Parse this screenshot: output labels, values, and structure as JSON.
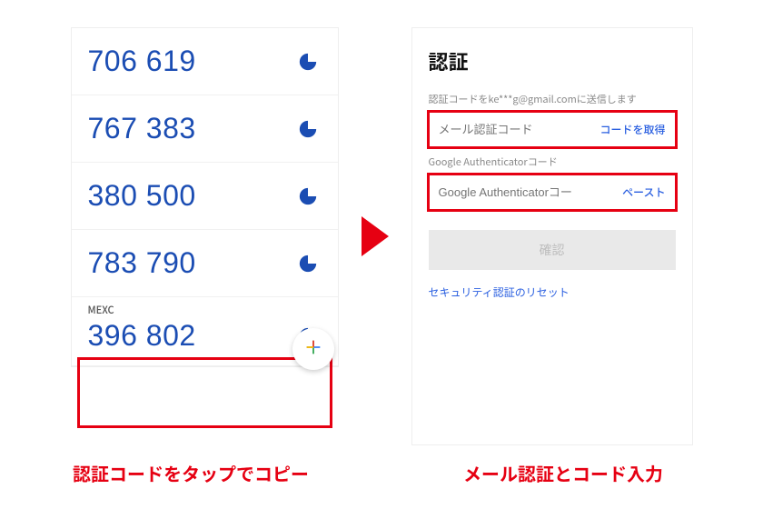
{
  "authenticator": {
    "codes": [
      {
        "code": "706 619"
      },
      {
        "code": "767 383"
      },
      {
        "code": "380 500"
      },
      {
        "code": "783 790"
      },
      {
        "code": "396 802",
        "label": "MEXC",
        "highlighted": true
      }
    ]
  },
  "verify": {
    "title": "認証",
    "sent_to": "認証コードをke***g@gmail.comに送信します",
    "email_placeholder": "メール認証コード",
    "get_code": "コードを取得",
    "ga_label": "Google Authenticatorコード",
    "ga_placeholder": "Google Authenticatorコード",
    "paste": "ペースト",
    "confirm": "確認",
    "reset": "セキュリティ認証のリセット"
  },
  "captions": {
    "left": "認証コードをタップでコピー",
    "right": "メール認証とコード入力"
  }
}
